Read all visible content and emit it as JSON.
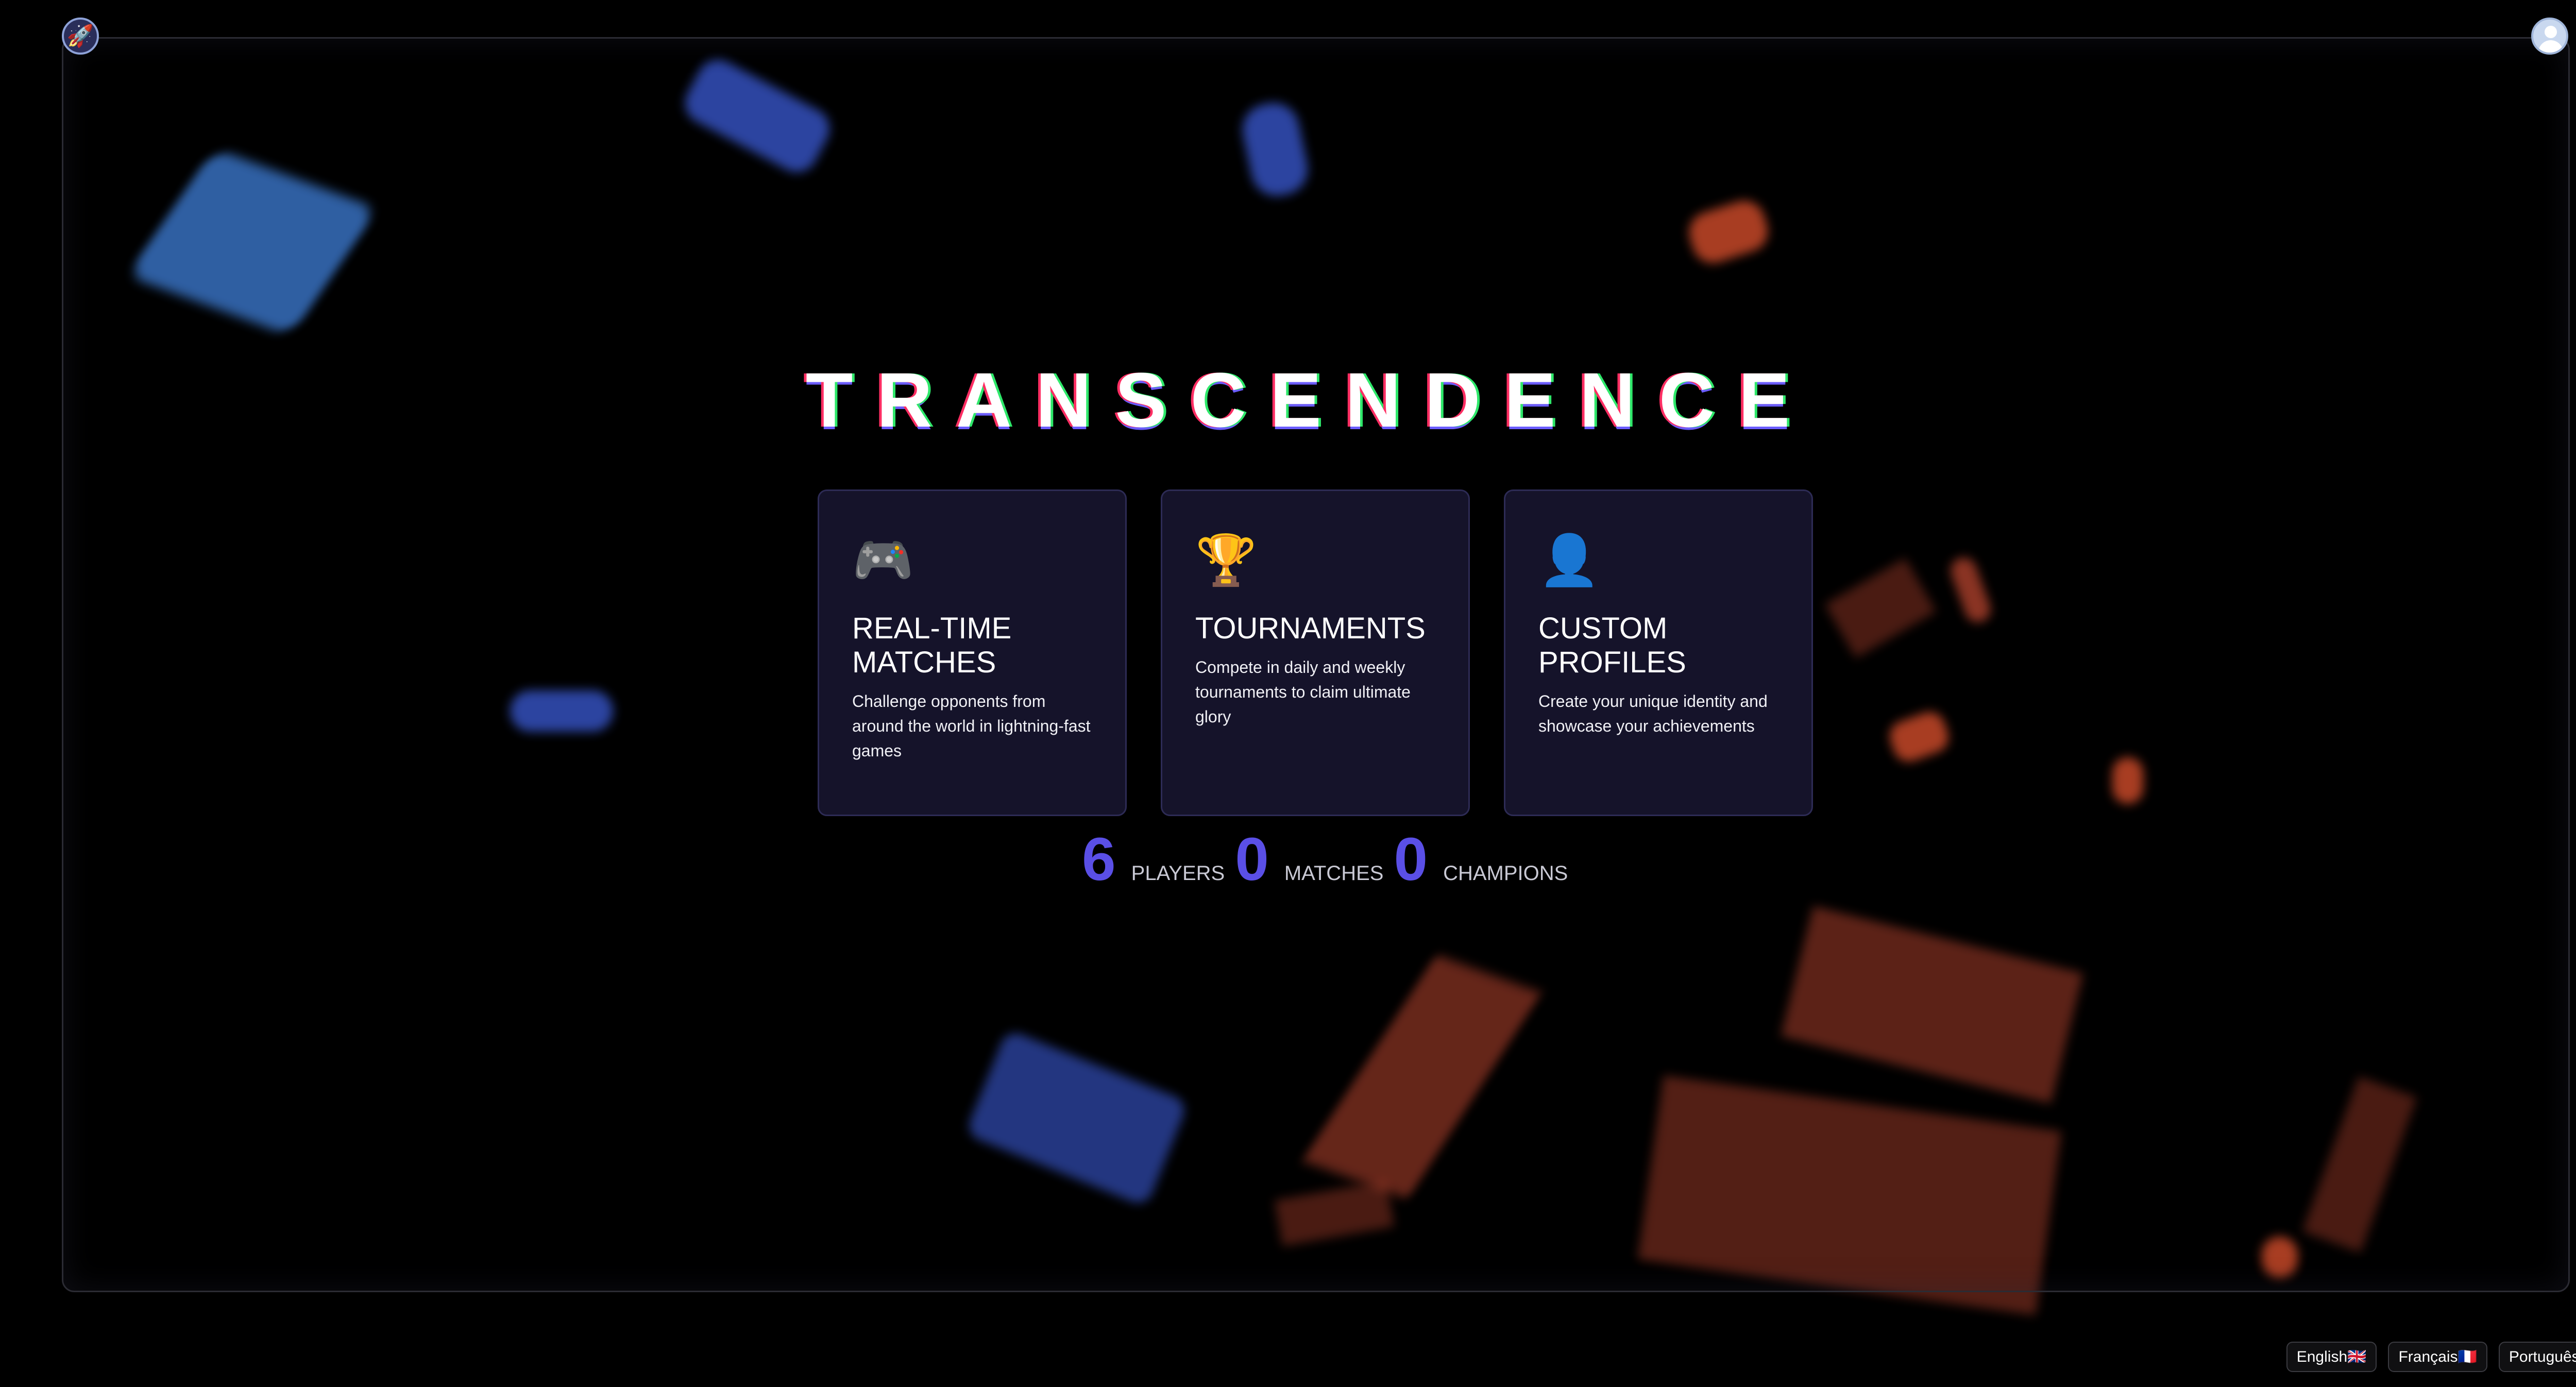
{
  "app": {
    "logo_icon": "rocket-icon",
    "profile_icon": "user-avatar-icon"
  },
  "hero": {
    "title": "TRANSCENDENCE"
  },
  "features": [
    {
      "icon": "🎮",
      "icon_name": "gamepad-icon",
      "title": "REAL-TIME MATCHES",
      "description": "Challenge opponents from around the world in lightning-fast games"
    },
    {
      "icon": "🏆",
      "icon_name": "trophy-icon",
      "title": "TOURNAMENTS",
      "description": "Compete in daily and weekly tournaments to claim ultimate glory"
    },
    {
      "icon": "👤",
      "icon_name": "profile-icon",
      "title": "CUSTOM PROFILES",
      "description": "Create your unique identity and showcase your achievements"
    }
  ],
  "stats": [
    {
      "value": "6",
      "label": "PLAYERS"
    },
    {
      "value": "0",
      "label": "MATCHES"
    },
    {
      "value": "0",
      "label": "CHAMPIONS"
    }
  ],
  "languages": [
    {
      "label": "English🇬🇧"
    },
    {
      "label": "Français🇫🇷"
    },
    {
      "label": "Português🇵🇹"
    }
  ],
  "colors": {
    "background": "#000000",
    "accent": "#5a4fe6",
    "card_bg": "#16142c"
  }
}
